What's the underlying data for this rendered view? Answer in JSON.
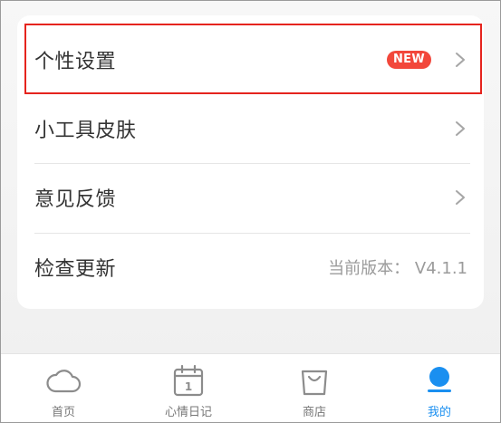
{
  "settings": {
    "items": [
      {
        "label": "个性设置",
        "badge": "NEW"
      },
      {
        "label": "小工具皮肤"
      },
      {
        "label": "意见反馈"
      },
      {
        "label": "检查更新",
        "value": "当前版本：  V4.1.1"
      }
    ]
  },
  "tabbar": {
    "tabs": [
      {
        "label": "首页",
        "icon": "cloud-icon"
      },
      {
        "label": "心情日记",
        "icon": "calendar-icon",
        "icon_text": "1"
      },
      {
        "label": "商店",
        "icon": "shopping-bag-icon"
      },
      {
        "label": "我的",
        "icon": "profile-dot-icon",
        "active": true
      }
    ]
  },
  "colors": {
    "accent": "#1a8ff0",
    "badge": "#f2473b",
    "highlight": "#e5241e"
  }
}
